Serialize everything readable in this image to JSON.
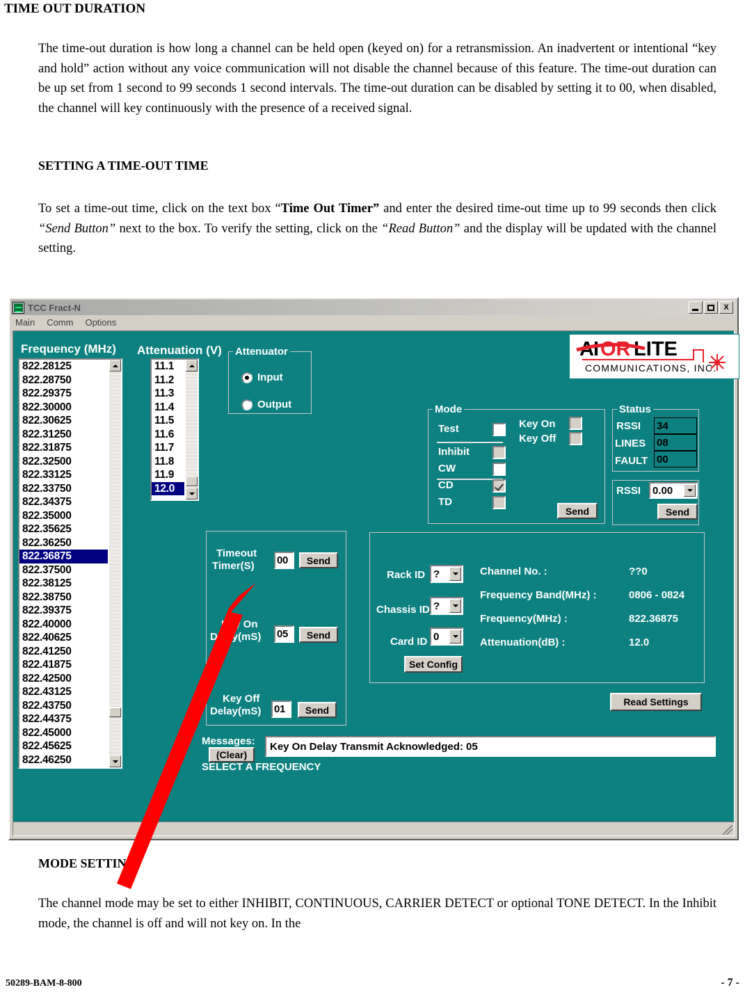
{
  "document": {
    "heading1": "TIME OUT DURATION",
    "para1": "The time-out duration is how long a channel can be held open (keyed on) for a retransmission. An inadvertent or intentional “key and hold” action without any voice communication will not disable the channel because of this feature. The time-out duration can be up set from 1 second to 99 seconds 1 second intervals. The time-out duration can be disabled by setting it to 00, when disabled, the channel will key continuously with the presence of a received signal.",
    "heading2": "SETTING A TIME-OUT TIME",
    "para2_a": "To set a time-out time, click on the text box “",
    "para2_b": "Time Out Timer”",
    "para2_c": " and enter the desired time-out time up to 99 seconds then click ",
    "para2_d": "“Send Button”",
    "para2_e": " next to the box. To verify the setting, click on the ",
    "para2_f": "“Read Button”",
    "para2_g": " and the display will be updated with the channel setting.",
    "heading3": "MODE SETTING",
    "para3": "The channel mode may be set to either INHIBIT, CONTINUOUS, CARRIER DETECT or optional TONE DETECT. In the Inhibit mode, the channel is off and will not key on. In the",
    "footer_left": "50289-BAM-8-800",
    "footer_right": "- 7 -"
  },
  "app": {
    "title": "TCC Fract-N",
    "menu": [
      "Main",
      "Comm",
      "Options"
    ],
    "window_buttons": {
      "minimize": "_",
      "maximize": "□",
      "close": "X"
    },
    "logo": {
      "line1": "AIRORLITE",
      "line2": "COMMUNICATIONS, INC."
    },
    "frequency": {
      "label": "Frequency (MHz)",
      "items": [
        "822.28125",
        "822.28750",
        "822.29375",
        "822.30000",
        "822.30625",
        "822.31250",
        "822.31875",
        "822.32500",
        "822.33125",
        "822.33750",
        "822.34375",
        "822.35000",
        "822.35625",
        "822.36250",
        "822.36875",
        "822.37500",
        "822.38125",
        "822.38750",
        "822.39375",
        "822.40000",
        "822.40625",
        "822.41250",
        "822.41875",
        "822.42500",
        "822.43125",
        "822.43750",
        "822.44375",
        "822.45000",
        "822.45625",
        "822.46250"
      ],
      "selected": "822.36875"
    },
    "attenuation": {
      "label": "Attenuation (V)",
      "items": [
        "11.1",
        "11.2",
        "11.3",
        "11.4",
        "11.5",
        "11.6",
        "11.7",
        "11.8",
        "11.9",
        "12.0"
      ],
      "selected": "12.0"
    },
    "attenuator": {
      "title": "Attenuator",
      "options": [
        "Input",
        "Output"
      ],
      "selected": "Input"
    },
    "mode": {
      "title": "Mode",
      "items": [
        {
          "label": "Test",
          "checked": false,
          "style": "white"
        },
        {
          "label": "Inhibit",
          "checked": false,
          "style": "gray"
        },
        {
          "label": "CW",
          "checked": false,
          "style": "white"
        },
        {
          "label": "CD",
          "checked": true,
          "style": "gray"
        },
        {
          "label": "TD",
          "checked": false,
          "style": "gray"
        }
      ],
      "key_on": {
        "label": "Key On",
        "checked": false
      },
      "key_off": {
        "label": "Key Off",
        "checked": false
      },
      "send_label": "Send"
    },
    "status": {
      "title": "Status",
      "rows": [
        {
          "label": "RSSI",
          "value": "34"
        },
        {
          "label": "LINES",
          "value": "08"
        },
        {
          "label": "FAULT",
          "value": "00"
        }
      ],
      "rssi_set": {
        "label": "RSSI",
        "value": "0.00",
        "send_label": "Send"
      }
    },
    "timers": {
      "timeout": {
        "label_line1": "Timeout",
        "label_line2": "Timer(S)",
        "value": "00",
        "send_label": "Send"
      },
      "key_on_delay": {
        "label_line1": "Key On",
        "label_line2": "Delay(mS)",
        "value": "05",
        "send_label": "Send"
      },
      "key_off_delay": {
        "label_line1": "Key Off",
        "label_line2": "Delay(mS)",
        "value": "01",
        "send_label": "Send"
      }
    },
    "config": {
      "rack_id": {
        "label": "Rack ID",
        "value": "?"
      },
      "chassis_id": {
        "label": "Chassis ID",
        "value": "?"
      },
      "card_id": {
        "label": "Card ID",
        "value": "0"
      },
      "set_config_label": "Set Config",
      "readout": [
        {
          "label": "Channel No. :",
          "value": "??0"
        },
        {
          "label": "Frequency Band(MHz) :",
          "value": "0806 - 0824"
        },
        {
          "label": "Frequency(MHz) :",
          "value": "822.36875"
        },
        {
          "label": "Attenuation(dB) :",
          "value": "12.0"
        }
      ]
    },
    "read_settings_label": "Read Settings",
    "messages": {
      "label": "Messages:",
      "clear_label": "(Clear)",
      "text": "Key On Delay Transmit Acknowledged: 05",
      "status_text": "SELECT A FREQUENCY"
    },
    "colors": {
      "client_teal": "#0d8080",
      "chrome": "#d4d0c8",
      "selection_blue": "#000080",
      "annotation_red": "#ff0000",
      "logo_red": "#e8202a"
    }
  }
}
